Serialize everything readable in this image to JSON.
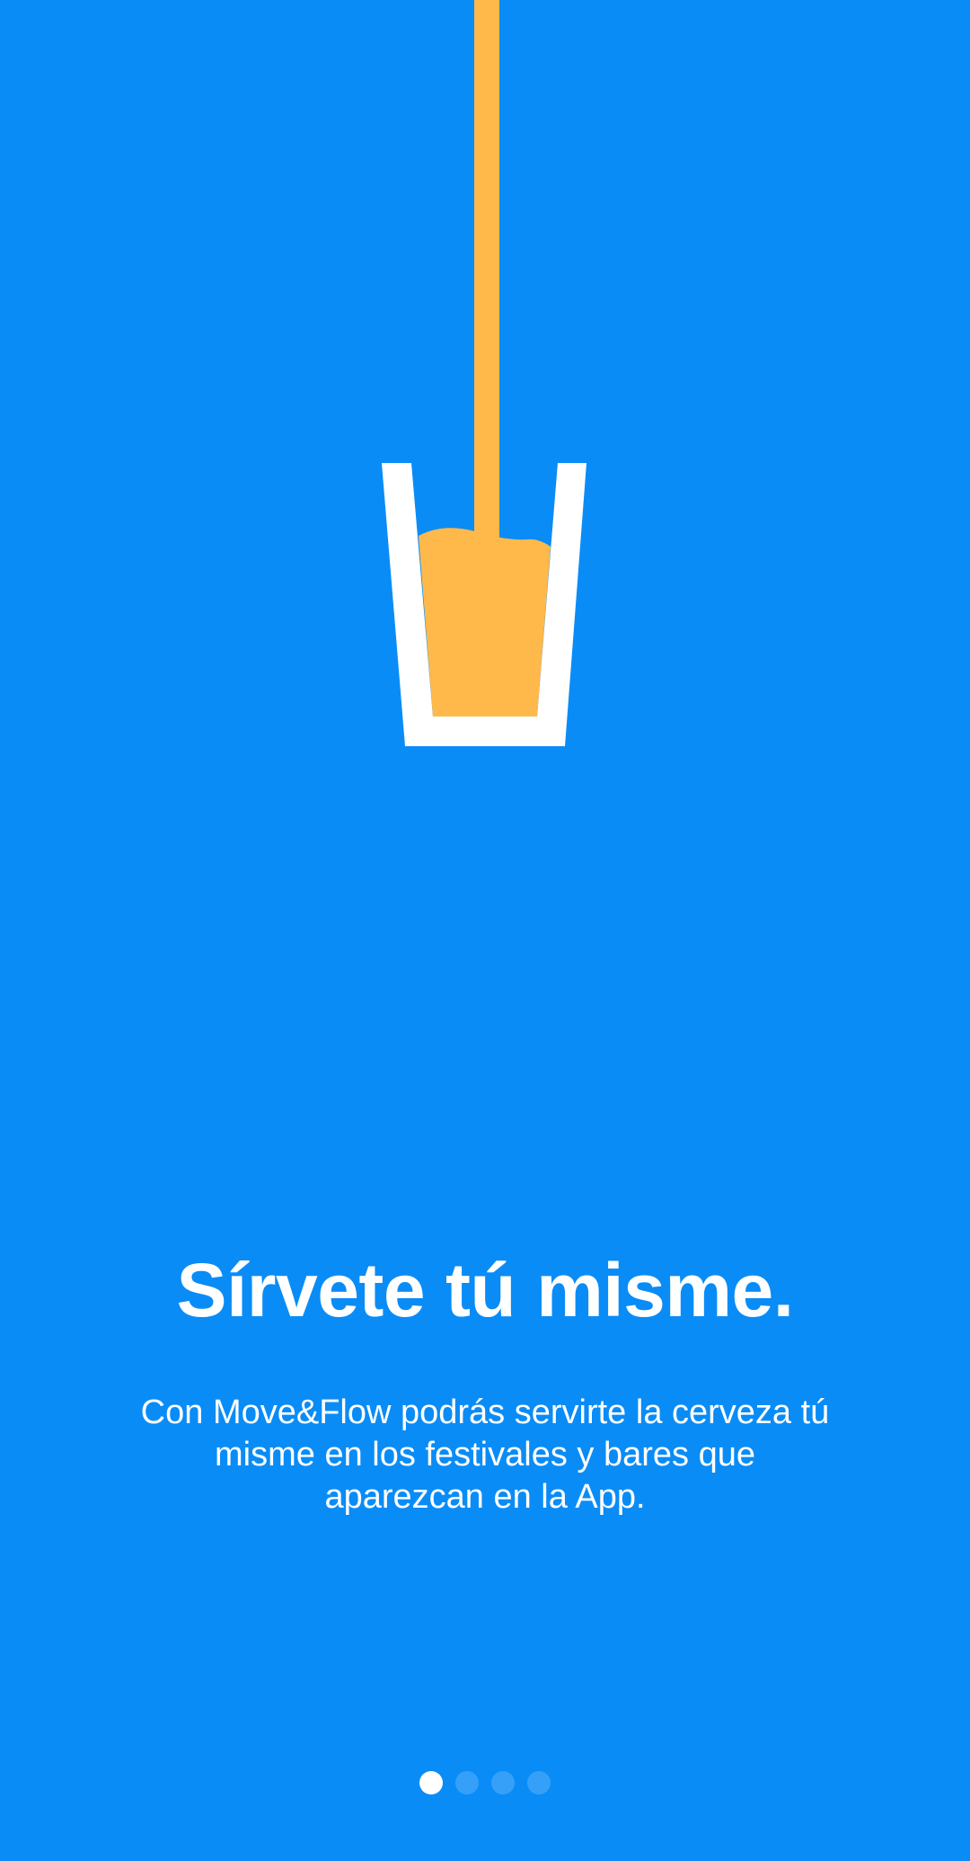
{
  "onboarding": {
    "title": "Sírvete tú misme.",
    "description": "Con Move&Flow podrás servirte la cerveza tú misme en los festivales y bares que aparezcan en la App.",
    "illustration_icon": "beer-glass-pour-icon",
    "page_indicator": {
      "total": 4,
      "active_index": 0
    }
  },
  "colors": {
    "background": "#0A8CF7",
    "beer": "#FFB94A",
    "glass": "#FFFFFF",
    "text": "#FFFFFF"
  }
}
